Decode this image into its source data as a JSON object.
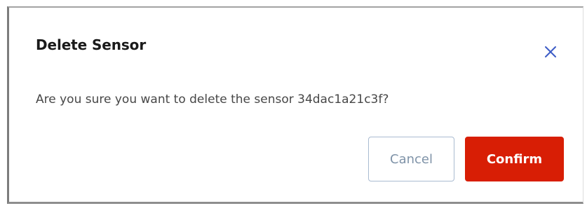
{
  "dialog": {
    "title": "Delete Sensor",
    "message": "Are you sure you want to delete the sensor 34dac1a21c3f?",
    "close_icon": "close-icon",
    "cancel_label": "Cancel",
    "confirm_label": "Confirm"
  },
  "colors": {
    "confirm_button": "#d81e05",
    "close_icon": "#3d5cc6",
    "cancel_text": "#7f93a8",
    "cancel_border": "#a9bbd1"
  }
}
